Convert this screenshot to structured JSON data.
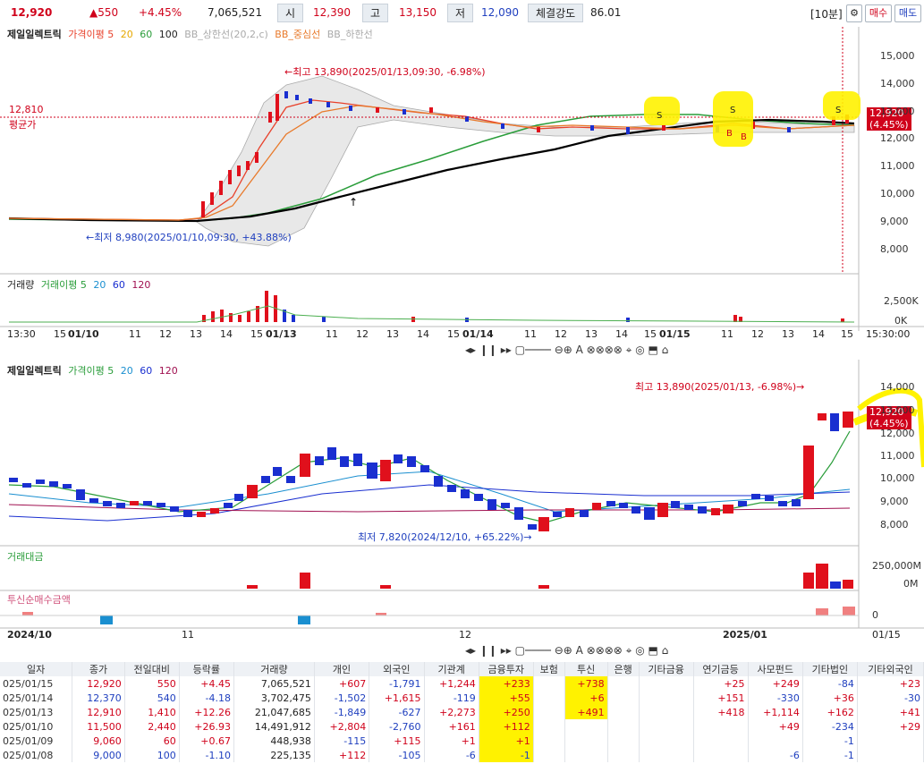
{
  "topbar": {
    "price": "12,920",
    "change": "▲550",
    "change_pct": "+4.45%",
    "volume": "7,065,521",
    "open_label": "시",
    "open": "12,390",
    "high_label": "고",
    "high": "13,150",
    "low_label": "저",
    "low": "12,090",
    "strength_label": "체결강도",
    "strength": "86.01",
    "interval": "[10분]",
    "buy_label": "매수",
    "sell_label": "매도"
  },
  "chart1": {
    "legend": [
      "제일일렉트릭",
      "가격이평 5",
      "20",
      "60",
      "100",
      "BB_상한선(20,2,c)",
      "BB_중심선",
      "BB_하한선"
    ],
    "yticks": [
      "15,000",
      "14,000",
      "13,000",
      "12,000",
      "11,000",
      "10,000",
      "9,000",
      "8,000"
    ],
    "max_note": "←최고 13,890(2025/01/13,09:30, -6.98%)",
    "min_note": "←최저 8,980(2025/01/10,09:30, +43.88%)",
    "avg_price": "12,810",
    "avg_label": "평균가",
    "current_tag": "12,920",
    "current_pct": "(4.45%)"
  },
  "vol1": {
    "legend": [
      "거래량",
      "거래이평 5",
      "20",
      "60",
      "120"
    ],
    "yticks": [
      "2,500K",
      "0K"
    ]
  },
  "xaxis1": [
    "13:30",
    "15",
    "01/10",
    "11",
    "12",
    "13",
    "14",
    "15",
    "01/13",
    "11",
    "12",
    "13",
    "14",
    "15",
    "01/14",
    "11",
    "12",
    "13",
    "14",
    "15",
    "01/15",
    "11",
    "12",
    "13",
    "14",
    "15",
    "15:30:00"
  ],
  "chart2": {
    "legend": [
      "제일일렉트릭",
      "가격이평 5",
      "20",
      "60",
      "120"
    ],
    "yticks": [
      "14,000",
      "13,000",
      "12,000",
      "11,000",
      "10,000",
      "9,000",
      "8,000"
    ],
    "max_note": "최고 13,890(2025/01/13, -6.98%)→",
    "min_note": "최저 7,820(2024/12/10, +65.22%)→",
    "current_tag": "12,920",
    "current_pct": "(4.45%)"
  },
  "vol2": {
    "legend": "거래대금",
    "yticks": [
      "250,000M",
      "0M"
    ]
  },
  "inst": {
    "legend": "투신순매수금액",
    "ytick": "0"
  },
  "xaxis2": [
    "2024/10",
    "11",
    "12",
    "2025/01",
    "01/15"
  ],
  "colors": {
    "up": "#e0101c",
    "down": "#1a2fd0",
    "ma5": "#e8412b",
    "ma20": "#2a9d3a",
    "ma60": "#222",
    "highlight": "#fff200"
  },
  "table": {
    "headers": [
      "일자",
      "종가",
      "전일대비",
      "등락률",
      "거래량",
      "개인",
      "외국인",
      "기관계",
      "금융투자",
      "보험",
      "투신",
      "은행",
      "기타금융",
      "연기금등",
      "사모펀드",
      "기타법인",
      "기타외국인"
    ],
    "rows": [
      [
        "025/01/15",
        "12,920",
        "550",
        "+4.45",
        "7,065,521",
        "+607",
        "-1,791",
        "+1,244",
        "+233",
        "",
        "+738",
        "",
        "",
        "+25",
        "+249",
        "-84",
        "+23"
      ],
      [
        "025/01/14",
        "12,370",
        "540",
        "-4.18",
        "3,702,475",
        "-1,502",
        "+1,615",
        "-119",
        "+55",
        "",
        "+6",
        "",
        "",
        "+151",
        "-330",
        "+36",
        "-30"
      ],
      [
        "025/01/13",
        "12,910",
        "1,410",
        "+12.26",
        "21,047,685",
        "-1,849",
        "-627",
        "+2,273",
        "+250",
        "",
        "+491",
        "",
        "",
        "+418",
        "+1,114",
        "+162",
        "+41"
      ],
      [
        "025/01/10",
        "11,500",
        "2,440",
        "+26.93",
        "14,491,912",
        "+2,804",
        "-2,760",
        "+161",
        "+112",
        "",
        "",
        "",
        "",
        "",
        "+49",
        "-234",
        "+29"
      ],
      [
        "025/01/09",
        "9,060",
        "60",
        "+0.67",
        "448,938",
        "-115",
        "+115",
        "+1",
        "+1",
        "",
        "",
        "",
        "",
        "",
        "",
        "-1",
        ""
      ],
      [
        "025/01/08",
        "9,000",
        "100",
        "-1.10",
        "225,135",
        "+112",
        "-105",
        "-6",
        "-1",
        "",
        "",
        "",
        "",
        "",
        "-6",
        "-1",
        ""
      ]
    ]
  }
}
